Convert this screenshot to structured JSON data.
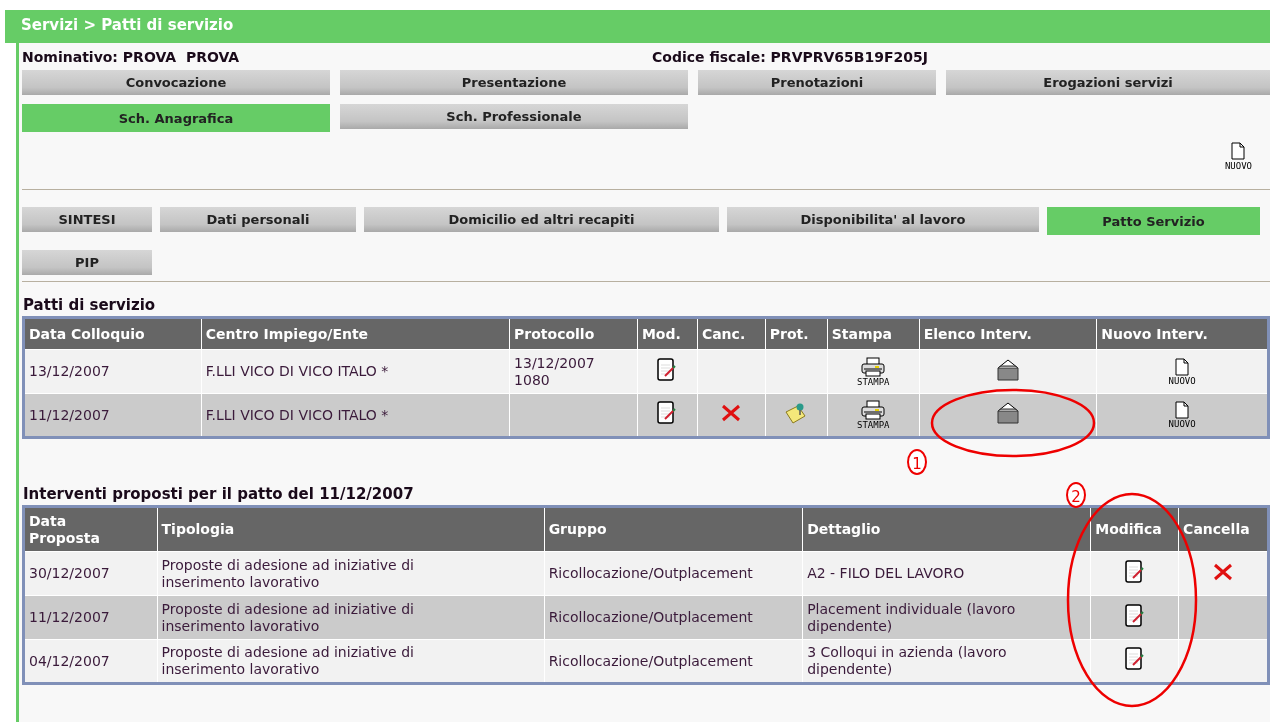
{
  "breadcrumb": "Servizi > Patti di servizio",
  "person": {
    "name_label": "Nominativo:",
    "name_value": "PROVA  PROVA",
    "cf_label": "Codice fiscale:",
    "cf_value": "PRVPRV65B19F205J"
  },
  "main_tabs": [
    {
      "label": "Convocazione",
      "selected": false
    },
    {
      "label": "Presentazione",
      "selected": false
    },
    {
      "label": "Prenotazioni",
      "selected": false
    },
    {
      "label": "Erogazioni servizi",
      "selected": false
    },
    {
      "label": "Sch. Anagrafica",
      "selected": true
    },
    {
      "label": "Sch. Professionale",
      "selected": false
    }
  ],
  "new_action": {
    "label": "NUOVO"
  },
  "sub_tabs": [
    {
      "label": "SINTESI",
      "selected": false
    },
    {
      "label": "Dati personali",
      "selected": false
    },
    {
      "label": "Domicilio ed altri recapiti",
      "selected": false
    },
    {
      "label": "Disponibilita' al lavoro",
      "selected": false
    },
    {
      "label": "Patto Servizio",
      "selected": true
    },
    {
      "label": "PIP",
      "selected": false
    }
  ],
  "pacts": {
    "title": "Patti di servizio",
    "columns": [
      "Data Colloquio",
      "Centro Impiego/Ente",
      "Protocollo",
      "Mod.",
      "Canc.",
      "Prot.",
      "Stampa",
      "Elenco Interv.",
      "Nuovo Interv."
    ],
    "rows": [
      {
        "cells": [
          {
            "kind": "text",
            "text": "13/12/2007"
          },
          {
            "kind": "text",
            "text": "F.LLI VICO DI VICO ITALO *"
          },
          {
            "kind": "text",
            "text": "13/12/2007\n1080"
          },
          {
            "kind": "edit"
          },
          {
            "kind": "empty"
          },
          {
            "kind": "empty"
          },
          {
            "kind": "print",
            "text": "STAMPA"
          },
          {
            "kind": "folder"
          },
          {
            "kind": "new",
            "text": "NUOVO"
          }
        ]
      },
      {
        "cells": [
          {
            "kind": "text",
            "text": "11/12/2007"
          },
          {
            "kind": "text",
            "text": "F.LLI VICO DI VICO ITALO *"
          },
          {
            "kind": "empty"
          },
          {
            "kind": "edit"
          },
          {
            "kind": "delete"
          },
          {
            "kind": "note"
          },
          {
            "kind": "print",
            "text": "STAMPA"
          },
          {
            "kind": "folder"
          },
          {
            "kind": "new",
            "text": "NUOVO"
          }
        ]
      }
    ]
  },
  "interventions": {
    "title": "Interventi proposti per il patto del 11/12/2007",
    "columns": [
      "Data\nProposta",
      "Tipologia",
      "Gruppo",
      "Dettaglio",
      "Modifica",
      "Cancella"
    ],
    "rows": [
      {
        "cells": [
          {
            "kind": "text",
            "text": "30/12/2007"
          },
          {
            "kind": "text",
            "text": "Proposte di adesione ad iniziative di\ninserimento lavorativo"
          },
          {
            "kind": "text",
            "text": "Ricollocazione/Outplacement"
          },
          {
            "kind": "text",
            "text": "A2 - FILO DEL LAVORO"
          },
          {
            "kind": "edit"
          },
          {
            "kind": "delete"
          }
        ]
      },
      {
        "cells": [
          {
            "kind": "text",
            "text": "11/12/2007"
          },
          {
            "kind": "text",
            "text": "Proposte di adesione ad iniziative di\ninserimento lavorativo"
          },
          {
            "kind": "text",
            "text": "Ricollocazione/Outplacement"
          },
          {
            "kind": "text",
            "text": "Placement individuale (lavoro\ndipendente)"
          },
          {
            "kind": "edit"
          },
          {
            "kind": "empty"
          }
        ]
      },
      {
        "cells": [
          {
            "kind": "text",
            "text": "04/12/2007"
          },
          {
            "kind": "text",
            "text": "Proposte di adesione ad iniziative di\ninserimento lavorativo"
          },
          {
            "kind": "text",
            "text": "Ricollocazione/Outplacement"
          },
          {
            "kind": "text",
            "text": "3 Colloqui in azienda (lavoro\ndipendente)"
          },
          {
            "kind": "edit"
          },
          {
            "kind": "empty"
          }
        ]
      }
    ]
  },
  "annotations": [
    {
      "label": "1"
    },
    {
      "label": "2"
    }
  ]
}
